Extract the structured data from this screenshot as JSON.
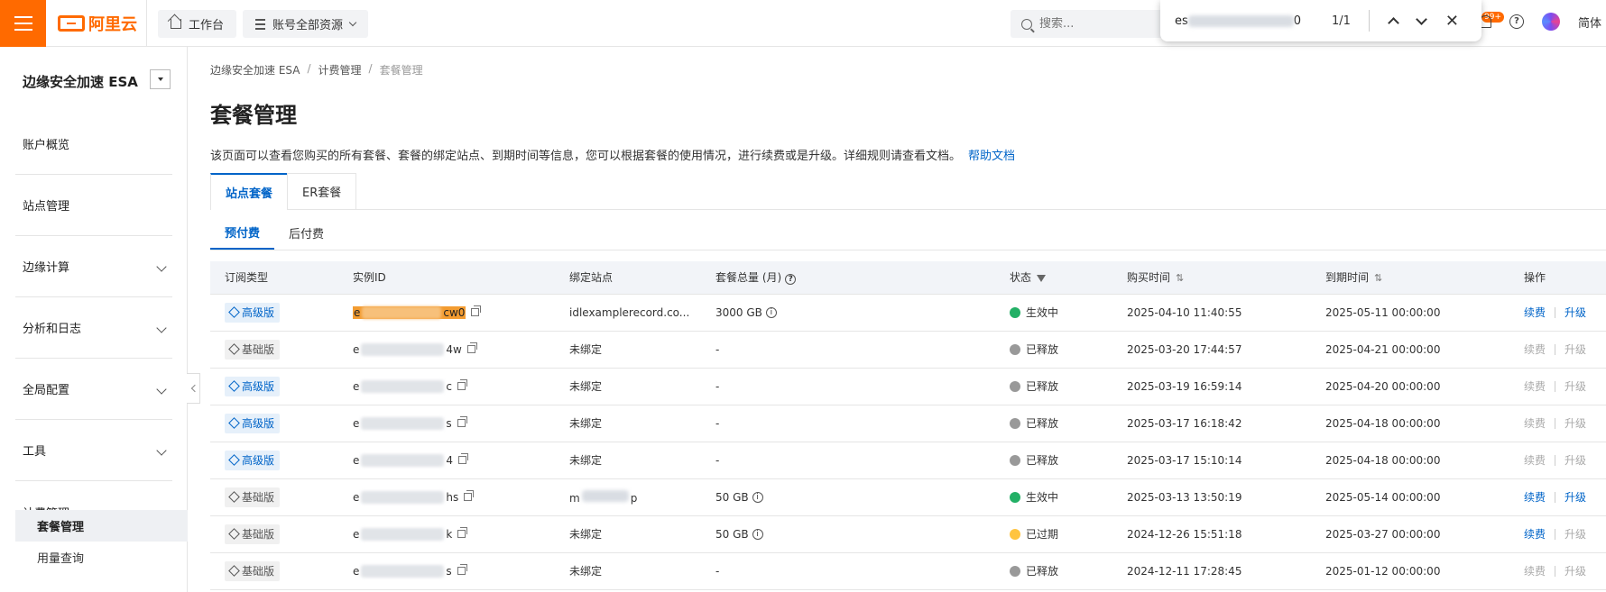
{
  "topbar": {
    "logo_text": "阿里云",
    "workbench": "工作台",
    "resources": "账号全部资源",
    "search_placeholder": "搜索...",
    "find": {
      "query_start": "es",
      "query_end": "0",
      "count": "1/1"
    },
    "badge": "99+",
    "lang": "简体"
  },
  "sidebar": {
    "product": "边缘安全加速 ESA",
    "items": [
      {
        "label": "账户概览",
        "expandable": false
      },
      {
        "label": "站点管理",
        "expandable": false
      },
      {
        "label": "边缘计算",
        "expandable": true
      },
      {
        "label": "分析和日志",
        "expandable": true
      },
      {
        "label": "全局配置",
        "expandable": true
      },
      {
        "label": "工具",
        "expandable": true
      },
      {
        "label": "计费管理",
        "expandable": true,
        "expanded": true
      }
    ],
    "sub_items": [
      {
        "label": "套餐管理",
        "active": true
      },
      {
        "label": "用量查询",
        "active": false
      }
    ]
  },
  "main": {
    "breadcrumb": [
      "边缘安全加速 ESA",
      "计费管理",
      "套餐管理"
    ],
    "title": "套餐管理",
    "description": "该页面可以查看您购买的所有套餐、套餐的绑定站点、到期时间等信息，您可以根据套餐的使用情况，进行续费或是升级。详细规则请查看文档。",
    "help_link": "帮助文档",
    "tabs": [
      "站点套餐",
      "ER套餐"
    ],
    "subtabs": [
      "预付费",
      "后付费"
    ],
    "table": {
      "columns": [
        "订阅类型",
        "实例ID",
        "绑定站点",
        "套餐总量 (月)",
        "状态",
        "购买时间",
        "到期时间",
        "操作"
      ],
      "rows": [
        {
          "type": "高级版",
          "tier": "pro",
          "id_start": "e",
          "id_end": "cw0",
          "highlight": true,
          "site": "idlexamplerecord.co...",
          "quota": "3000 GB",
          "quota_info": true,
          "status": "生效中",
          "status_color": "green",
          "purchase": "2025-04-10 11:40:55",
          "expire": "2025-05-11 00:00:00",
          "renew": "续费",
          "upgrade": "升级",
          "enabled": true
        },
        {
          "type": "基础版",
          "tier": "basic",
          "id_start": "e",
          "id_end": "4w",
          "highlight": false,
          "site": "未绑定",
          "quota": "-",
          "quota_info": false,
          "status": "已释放",
          "status_color": "gray",
          "purchase": "2025-03-20 17:44:57",
          "expire": "2025-04-21 00:00:00",
          "renew": "续费",
          "upgrade": "升级",
          "enabled": false
        },
        {
          "type": "高级版",
          "tier": "pro",
          "id_start": "e",
          "id_end": "c",
          "highlight": false,
          "site": "未绑定",
          "quota": "-",
          "quota_info": false,
          "status": "已释放",
          "status_color": "gray",
          "purchase": "2025-03-19 16:59:14",
          "expire": "2025-04-20 00:00:00",
          "renew": "续费",
          "upgrade": "升级",
          "enabled": false
        },
        {
          "type": "高级版",
          "tier": "pro",
          "id_start": "e",
          "id_end": "s",
          "highlight": false,
          "site": "未绑定",
          "quota": "-",
          "quota_info": false,
          "status": "已释放",
          "status_color": "gray",
          "purchase": "2025-03-17 16:18:42",
          "expire": "2025-04-18 00:00:00",
          "renew": "续费",
          "upgrade": "升级",
          "enabled": false
        },
        {
          "type": "高级版",
          "tier": "pro",
          "id_start": "e",
          "id_end": "4",
          "highlight": false,
          "site": "未绑定",
          "quota": "-",
          "quota_info": false,
          "status": "已释放",
          "status_color": "gray",
          "purchase": "2025-03-17 15:10:14",
          "expire": "2025-04-18 00:00:00",
          "renew": "续费",
          "upgrade": "升级",
          "enabled": false
        },
        {
          "type": "基础版",
          "tier": "basic",
          "id_start": "e",
          "id_end": "hs",
          "highlight": false,
          "site": "m p",
          "quota": "50 GB",
          "quota_info": true,
          "status": "生效中",
          "status_color": "green",
          "purchase": "2025-03-13 13:50:19",
          "expire": "2025-05-14 00:00:00",
          "renew": "续费",
          "upgrade": "升级",
          "enabled": true
        },
        {
          "type": "基础版",
          "tier": "basic",
          "id_start": "e",
          "id_end": "k",
          "highlight": false,
          "site": "未绑定",
          "quota": "50 GB",
          "quota_info": true,
          "status": "已过期",
          "status_color": "yellow",
          "purchase": "2024-12-26 15:51:18",
          "expire": "2025-03-27 00:00:00",
          "renew": "续费",
          "upgrade": "升级",
          "enabled": "renew-only"
        },
        {
          "type": "基础版",
          "tier": "basic",
          "id_start": "e",
          "id_end": "s",
          "highlight": false,
          "site": "未绑定",
          "quota": "-",
          "quota_info": false,
          "status": "已释放",
          "status_color": "gray",
          "purchase": "2024-12-11 17:28:45",
          "expire": "2025-01-12 00:00:00",
          "renew": "续费",
          "upgrade": "升级",
          "enabled": false
        }
      ]
    }
  }
}
